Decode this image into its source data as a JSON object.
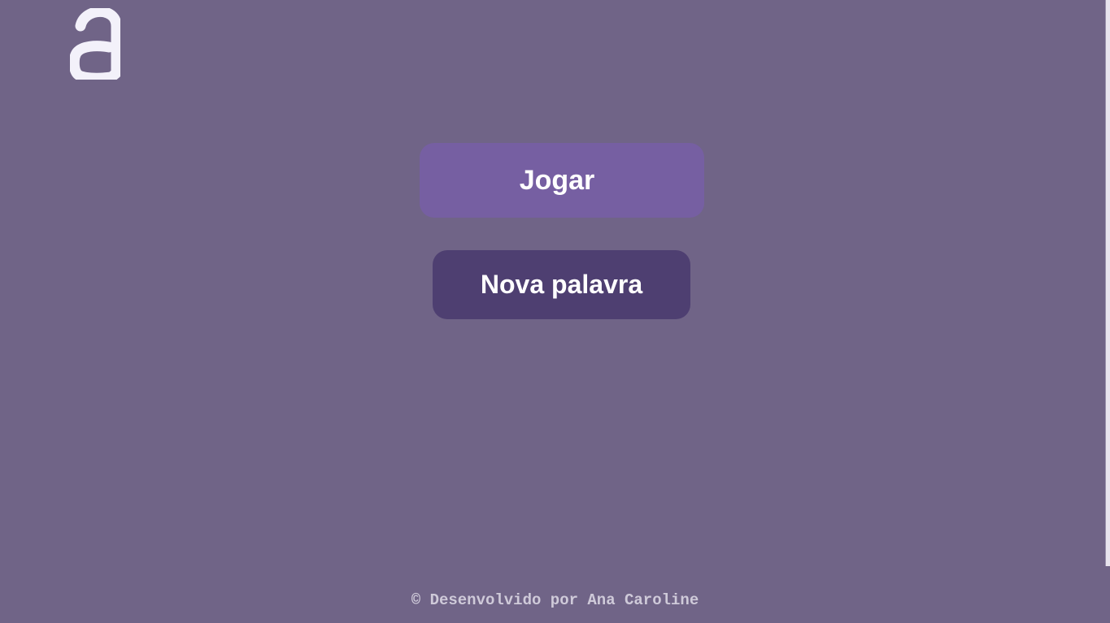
{
  "logo": {
    "icon": "a-letter-logo-icon",
    "color": "#f3f1fa"
  },
  "buttons": {
    "play_label": "Jogar",
    "new_word_label": "Nova palavra"
  },
  "footer": {
    "text": "© Desenvolvido por Ana Caroline"
  },
  "colors": {
    "background": "#706487",
    "play_button": "#765fa2",
    "new_word_button": "#4e3f71"
  }
}
